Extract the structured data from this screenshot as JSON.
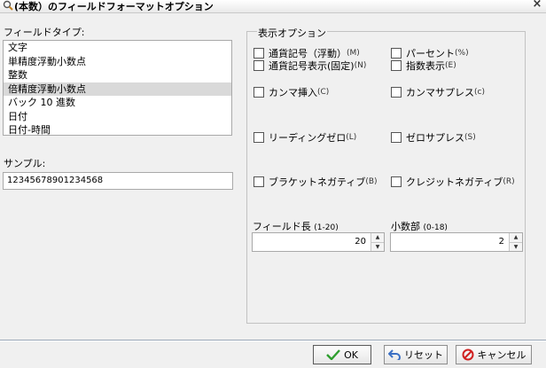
{
  "window": {
    "title": "(本数）のフィールドフォーマットオプション",
    "close_glyph": "×"
  },
  "field_type": {
    "label": "フィールドタイプ:",
    "items": [
      "文字",
      "単精度浮動小数点",
      "整数",
      "倍精度浮動小数点",
      "バック 10 進数",
      "日付",
      "日付-時間"
    ],
    "selected_index": 3
  },
  "sample": {
    "label": "サンプル:",
    "value": "12345678901234568"
  },
  "display_options": {
    "title": "表示オプション",
    "options": [
      {
        "label": "通貨記号（浮動）",
        "accel": "(M)",
        "checked": false
      },
      {
        "label": "パーセント",
        "accel": "(%)",
        "checked": false
      },
      {
        "label": "通貨記号表示(固定)",
        "accel": "(N)",
        "checked": false
      },
      {
        "label": "指数表示",
        "accel": "(E)",
        "checked": false
      },
      {
        "label": "カンマ挿入",
        "accel": "(C)",
        "checked": false
      },
      {
        "label": "カンマサプレス",
        "accel": "(c)",
        "checked": false
      },
      {
        "label": "リーディングゼロ",
        "accel": "(L)",
        "checked": false
      },
      {
        "label": "ゼロサプレス",
        "accel": "(S)",
        "checked": false
      },
      {
        "label": "ブラケットネガティブ",
        "accel": "(B)",
        "checked": false
      },
      {
        "label": "クレジットネガティブ",
        "accel": "(R)",
        "checked": false
      }
    ]
  },
  "field_length": {
    "label": "フィールド長",
    "range": "(1-20)",
    "value": "20"
  },
  "decimals": {
    "label": "小数部",
    "range": "(0-18)",
    "value": "2"
  },
  "buttons": {
    "ok": "OK",
    "reset": "リセット",
    "cancel": "キャンセル"
  },
  "colors": {
    "selection": "#d9d9d9",
    "ok_check": "#2e9e2e",
    "reset_arrow": "#3a6fc4",
    "cancel_icon": "#d02020"
  }
}
